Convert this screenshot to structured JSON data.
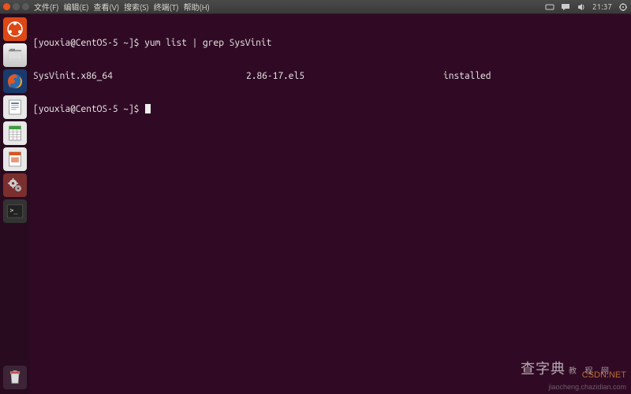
{
  "panel": {
    "menu": [
      "文件(F)",
      "编辑(E)",
      "查看(V)",
      "搜索(S)",
      "终端(T)",
      "帮助(H)"
    ],
    "clock": "21:37"
  },
  "launcher": {
    "items": [
      {
        "name": "dash-icon"
      },
      {
        "name": "files-icon"
      },
      {
        "name": "firefox-icon"
      },
      {
        "name": "writer-icon"
      },
      {
        "name": "calc-icon"
      },
      {
        "name": "impress-icon"
      },
      {
        "name": "settings-icon"
      },
      {
        "name": "terminal-icon"
      }
    ],
    "trash": {
      "name": "trash-icon"
    }
  },
  "terminal": {
    "prompt": "[youxia@CentOS-5 ~]$",
    "lines": [
      {
        "prompt": "[youxia@CentOS-5 ~]$ ",
        "text": "yum list | grep SysVinit"
      },
      {
        "col1": "SysVinit.x86_64",
        "col2": "2.86-17.el5",
        "col3": "installed"
      },
      {
        "prompt": "[youxia@CentOS-5 ~]$ ",
        "text": "",
        "cursor": true
      }
    ]
  },
  "watermarks": {
    "main": "查字典",
    "sub": "教 程 网",
    "corner": "CSDN.NET",
    "url": "jiaocheng.chazidian.com"
  }
}
